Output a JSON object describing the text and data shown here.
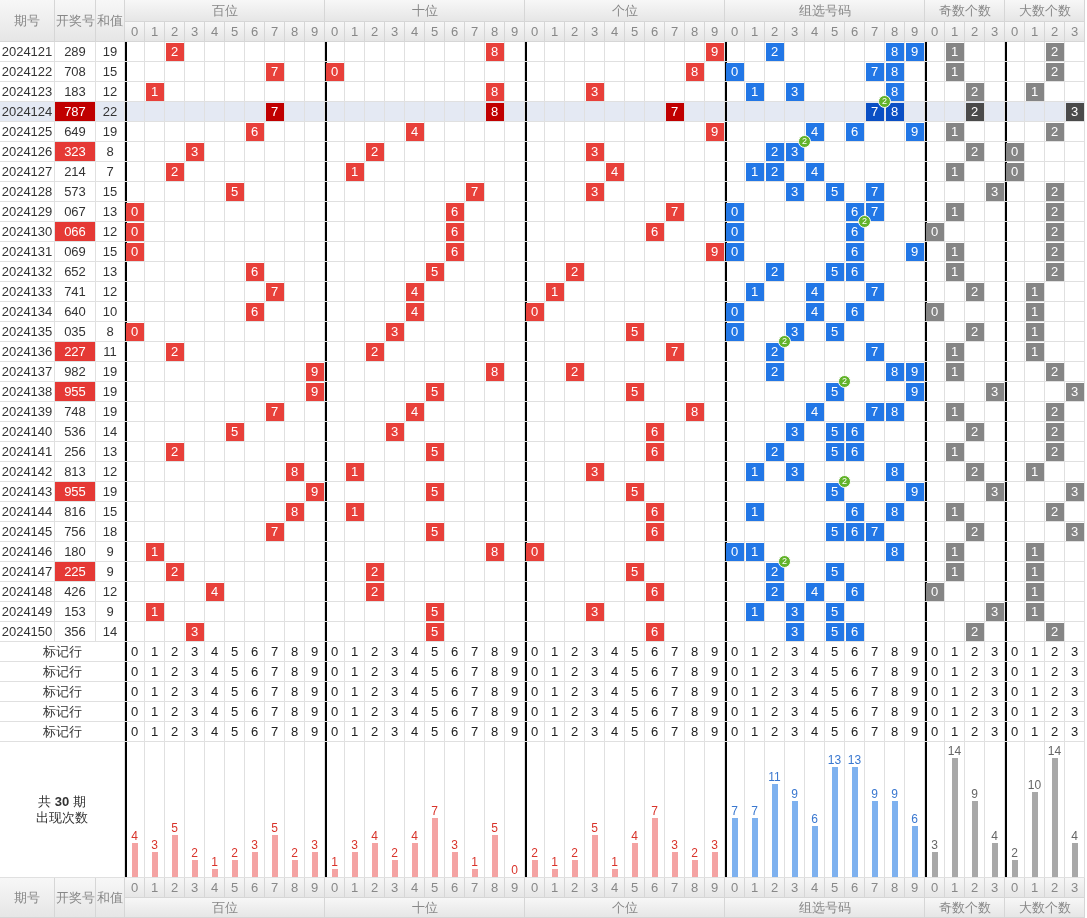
{
  "columns": [
    "期号",
    "开奖号",
    "和值"
  ],
  "groups": [
    {
      "label": "百位",
      "kind": "position",
      "digits": [
        "0",
        "1",
        "2",
        "3",
        "4",
        "5",
        "6",
        "7",
        "8",
        "9"
      ]
    },
    {
      "label": "十位",
      "kind": "position",
      "digits": [
        "0",
        "1",
        "2",
        "3",
        "4",
        "5",
        "6",
        "7",
        "8",
        "9"
      ]
    },
    {
      "label": "个位",
      "kind": "position",
      "digits": [
        "0",
        "1",
        "2",
        "3",
        "4",
        "5",
        "6",
        "7",
        "8",
        "9"
      ]
    },
    {
      "label": "组选号码",
      "kind": "group",
      "digits": [
        "0",
        "1",
        "2",
        "3",
        "4",
        "5",
        "6",
        "7",
        "8",
        "9"
      ]
    },
    {
      "label": "奇数个数",
      "kind": "odd",
      "digits": [
        "0",
        "1",
        "2",
        "3"
      ]
    },
    {
      "label": "大数个数",
      "kind": "big",
      "digits": [
        "0",
        "1",
        "2",
        "3"
      ]
    }
  ],
  "rows": [
    {
      "issue": "2024121",
      "number": "289",
      "sum": "19",
      "pair": false,
      "selected": false,
      "positions": [
        "2",
        "8",
        "9"
      ],
      "group": [
        {
          "digit": "2"
        },
        {
          "digit": "8"
        },
        {
          "digit": "9"
        }
      ],
      "odd": "1",
      "big": "2"
    },
    {
      "issue": "2024122",
      "number": "708",
      "sum": "15",
      "pair": false,
      "selected": false,
      "positions": [
        "7",
        "0",
        "8"
      ],
      "group": [
        {
          "digit": "0"
        },
        {
          "digit": "7"
        },
        {
          "digit": "8"
        }
      ],
      "odd": "1",
      "big": "2"
    },
    {
      "issue": "2024123",
      "number": "183",
      "sum": "12",
      "pair": false,
      "selected": false,
      "positions": [
        "1",
        "8",
        "3"
      ],
      "group": [
        {
          "digit": "1"
        },
        {
          "digit": "3"
        },
        {
          "digit": "8"
        }
      ],
      "odd": "2",
      "big": "1"
    },
    {
      "issue": "2024124",
      "number": "787",
      "sum": "22",
      "pair": true,
      "selected": true,
      "positions": [
        "7",
        "8",
        "7"
      ],
      "group": [
        {
          "digit": "7",
          "repeat": "2"
        },
        {
          "digit": "8"
        }
      ],
      "odd": "2",
      "big": "3"
    },
    {
      "issue": "2024125",
      "number": "649",
      "sum": "19",
      "pair": false,
      "selected": false,
      "positions": [
        "6",
        "4",
        "9"
      ],
      "group": [
        {
          "digit": "4"
        },
        {
          "digit": "6"
        },
        {
          "digit": "9"
        }
      ],
      "odd": "1",
      "big": "2"
    },
    {
      "issue": "2024126",
      "number": "323",
      "sum": "8",
      "pair": true,
      "selected": false,
      "positions": [
        "3",
        "2",
        "3"
      ],
      "group": [
        {
          "digit": "2"
        },
        {
          "digit": "3",
          "repeat": "2"
        }
      ],
      "odd": "2",
      "big": "0"
    },
    {
      "issue": "2024127",
      "number": "214",
      "sum": "7",
      "pair": false,
      "selected": false,
      "positions": [
        "2",
        "1",
        "4"
      ],
      "group": [
        {
          "digit": "1"
        },
        {
          "digit": "2"
        },
        {
          "digit": "4"
        }
      ],
      "odd": "1",
      "big": "0"
    },
    {
      "issue": "2024128",
      "number": "573",
      "sum": "15",
      "pair": false,
      "selected": false,
      "positions": [
        "5",
        "7",
        "3"
      ],
      "group": [
        {
          "digit": "3"
        },
        {
          "digit": "5"
        },
        {
          "digit": "7"
        }
      ],
      "odd": "3",
      "big": "2"
    },
    {
      "issue": "2024129",
      "number": "067",
      "sum": "13",
      "pair": false,
      "selected": false,
      "positions": [
        "0",
        "6",
        "7"
      ],
      "group": [
        {
          "digit": "0"
        },
        {
          "digit": "6"
        },
        {
          "digit": "7"
        }
      ],
      "odd": "1",
      "big": "2"
    },
    {
      "issue": "2024130",
      "number": "066",
      "sum": "12",
      "pair": true,
      "selected": false,
      "positions": [
        "0",
        "6",
        "6"
      ],
      "group": [
        {
          "digit": "0"
        },
        {
          "digit": "6",
          "repeat": "2"
        }
      ],
      "odd": "0",
      "big": "2"
    },
    {
      "issue": "2024131",
      "number": "069",
      "sum": "15",
      "pair": false,
      "selected": false,
      "positions": [
        "0",
        "6",
        "9"
      ],
      "group": [
        {
          "digit": "0"
        },
        {
          "digit": "6"
        },
        {
          "digit": "9"
        }
      ],
      "odd": "1",
      "big": "2"
    },
    {
      "issue": "2024132",
      "number": "652",
      "sum": "13",
      "pair": false,
      "selected": false,
      "positions": [
        "6",
        "5",
        "2"
      ],
      "group": [
        {
          "digit": "2"
        },
        {
          "digit": "5"
        },
        {
          "digit": "6"
        }
      ],
      "odd": "1",
      "big": "2"
    },
    {
      "issue": "2024133",
      "number": "741",
      "sum": "12",
      "pair": false,
      "selected": false,
      "positions": [
        "7",
        "4",
        "1"
      ],
      "group": [
        {
          "digit": "1"
        },
        {
          "digit": "4"
        },
        {
          "digit": "7"
        }
      ],
      "odd": "2",
      "big": "1"
    },
    {
      "issue": "2024134",
      "number": "640",
      "sum": "10",
      "pair": false,
      "selected": false,
      "positions": [
        "6",
        "4",
        "0"
      ],
      "group": [
        {
          "digit": "0"
        },
        {
          "digit": "4"
        },
        {
          "digit": "6"
        }
      ],
      "odd": "0",
      "big": "1"
    },
    {
      "issue": "2024135",
      "number": "035",
      "sum": "8",
      "pair": false,
      "selected": false,
      "positions": [
        "0",
        "3",
        "5"
      ],
      "group": [
        {
          "digit": "0"
        },
        {
          "digit": "3"
        },
        {
          "digit": "5"
        }
      ],
      "odd": "2",
      "big": "1"
    },
    {
      "issue": "2024136",
      "number": "227",
      "sum": "11",
      "pair": true,
      "selected": false,
      "positions": [
        "2",
        "2",
        "7"
      ],
      "group": [
        {
          "digit": "2",
          "repeat": "2"
        },
        {
          "digit": "7"
        }
      ],
      "odd": "1",
      "big": "1"
    },
    {
      "issue": "2024137",
      "number": "982",
      "sum": "19",
      "pair": false,
      "selected": false,
      "positions": [
        "9",
        "8",
        "2"
      ],
      "group": [
        {
          "digit": "2"
        },
        {
          "digit": "8"
        },
        {
          "digit": "9"
        }
      ],
      "odd": "1",
      "big": "2"
    },
    {
      "issue": "2024138",
      "number": "955",
      "sum": "19",
      "pair": true,
      "selected": false,
      "positions": [
        "9",
        "5",
        "5"
      ],
      "group": [
        {
          "digit": "5",
          "repeat": "2"
        },
        {
          "digit": "9"
        }
      ],
      "odd": "3",
      "big": "3"
    },
    {
      "issue": "2024139",
      "number": "748",
      "sum": "19",
      "pair": false,
      "selected": false,
      "positions": [
        "7",
        "4",
        "8"
      ],
      "group": [
        {
          "digit": "4"
        },
        {
          "digit": "7"
        },
        {
          "digit": "8"
        }
      ],
      "odd": "1",
      "big": "2"
    },
    {
      "issue": "2024140",
      "number": "536",
      "sum": "14",
      "pair": false,
      "selected": false,
      "positions": [
        "5",
        "3",
        "6"
      ],
      "group": [
        {
          "digit": "3"
        },
        {
          "digit": "5"
        },
        {
          "digit": "6"
        }
      ],
      "odd": "2",
      "big": "2"
    },
    {
      "issue": "2024141",
      "number": "256",
      "sum": "13",
      "pair": false,
      "selected": false,
      "positions": [
        "2",
        "5",
        "6"
      ],
      "group": [
        {
          "digit": "2"
        },
        {
          "digit": "5"
        },
        {
          "digit": "6"
        }
      ],
      "odd": "1",
      "big": "2"
    },
    {
      "issue": "2024142",
      "number": "813",
      "sum": "12",
      "pair": false,
      "selected": false,
      "positions": [
        "8",
        "1",
        "3"
      ],
      "group": [
        {
          "digit": "1"
        },
        {
          "digit": "3"
        },
        {
          "digit": "8"
        }
      ],
      "odd": "2",
      "big": "1"
    },
    {
      "issue": "2024143",
      "number": "955",
      "sum": "19",
      "pair": true,
      "selected": false,
      "positions": [
        "9",
        "5",
        "5"
      ],
      "group": [
        {
          "digit": "5",
          "repeat": "2"
        },
        {
          "digit": "9"
        }
      ],
      "odd": "3",
      "big": "3"
    },
    {
      "issue": "2024144",
      "number": "816",
      "sum": "15",
      "pair": false,
      "selected": false,
      "positions": [
        "8",
        "1",
        "6"
      ],
      "group": [
        {
          "digit": "1"
        },
        {
          "digit": "6"
        },
        {
          "digit": "8"
        }
      ],
      "odd": "1",
      "big": "2"
    },
    {
      "issue": "2024145",
      "number": "756",
      "sum": "18",
      "pair": false,
      "selected": false,
      "positions": [
        "7",
        "5",
        "6"
      ],
      "group": [
        {
          "digit": "5"
        },
        {
          "digit": "6"
        },
        {
          "digit": "7"
        }
      ],
      "odd": "2",
      "big": "3"
    },
    {
      "issue": "2024146",
      "number": "180",
      "sum": "9",
      "pair": false,
      "selected": false,
      "positions": [
        "1",
        "8",
        "0"
      ],
      "group": [
        {
          "digit": "0"
        },
        {
          "digit": "1"
        },
        {
          "digit": "8"
        }
      ],
      "odd": "1",
      "big": "1"
    },
    {
      "issue": "2024147",
      "number": "225",
      "sum": "9",
      "pair": true,
      "selected": false,
      "positions": [
        "2",
        "2",
        "5"
      ],
      "group": [
        {
          "digit": "2",
          "repeat": "2"
        },
        {
          "digit": "5"
        }
      ],
      "odd": "1",
      "big": "1"
    },
    {
      "issue": "2024148",
      "number": "426",
      "sum": "12",
      "pair": false,
      "selected": false,
      "positions": [
        "4",
        "2",
        "6"
      ],
      "group": [
        {
          "digit": "2"
        },
        {
          "digit": "4"
        },
        {
          "digit": "6"
        }
      ],
      "odd": "0",
      "big": "1"
    },
    {
      "issue": "2024149",
      "number": "153",
      "sum": "9",
      "pair": false,
      "selected": false,
      "positions": [
        "1",
        "5",
        "3"
      ],
      "group": [
        {
          "digit": "1"
        },
        {
          "digit": "3"
        },
        {
          "digit": "5"
        }
      ],
      "odd": "3",
      "big": "1"
    },
    {
      "issue": "2024150",
      "number": "356",
      "sum": "14",
      "pair": false,
      "selected": false,
      "positions": [
        "3",
        "5",
        "6"
      ],
      "group": [
        {
          "digit": "3"
        },
        {
          "digit": "5"
        },
        {
          "digit": "6"
        }
      ],
      "odd": "2",
      "big": "2"
    }
  ],
  "mark_rows": [
    {
      "label": "标记行",
      "digits": [
        [
          "0",
          "1",
          "2",
          "3",
          "4",
          "5",
          "6",
          "7",
          "8",
          "9"
        ],
        [
          "0",
          "1",
          "2",
          "3",
          "4",
          "5",
          "6",
          "7",
          "8",
          "9"
        ],
        [
          "0",
          "1",
          "2",
          "3",
          "4",
          "5",
          "6",
          "7",
          "8",
          "9"
        ],
        [
          "0",
          "1",
          "2",
          "3",
          "4",
          "5",
          "6",
          "7",
          "8",
          "9"
        ],
        [
          "0",
          "1",
          "2",
          "3"
        ],
        [
          "0",
          "1",
          "2",
          "3"
        ]
      ]
    },
    {
      "label": "标记行",
      "digits": [
        [
          "0",
          "1",
          "2",
          "3",
          "4",
          "5",
          "6",
          "7",
          "8",
          "9"
        ],
        [
          "0",
          "1",
          "2",
          "3",
          "4",
          "5",
          "6",
          "7",
          "8",
          "9"
        ],
        [
          "0",
          "1",
          "2",
          "3",
          "4",
          "5",
          "6",
          "7",
          "8",
          "9"
        ],
        [
          "0",
          "1",
          "2",
          "3",
          "4",
          "5",
          "6",
          "7",
          "8",
          "9"
        ],
        [
          "0",
          "1",
          "2",
          "3"
        ],
        [
          "0",
          "1",
          "2",
          "3"
        ]
      ]
    },
    {
      "label": "标记行",
      "digits": [
        [
          "0",
          "1",
          "2",
          "3",
          "4",
          "5",
          "6",
          "7",
          "8",
          "9"
        ],
        [
          "0",
          "1",
          "2",
          "3",
          "4",
          "5",
          "6",
          "7",
          "8",
          "9"
        ],
        [
          "0",
          "1",
          "2",
          "3",
          "4",
          "5",
          "6",
          "7",
          "8",
          "9"
        ],
        [
          "0",
          "1",
          "2",
          "3",
          "4",
          "5",
          "6",
          "7",
          "8",
          "9"
        ],
        [
          "0",
          "1",
          "2",
          "3"
        ],
        [
          "0",
          "1",
          "2",
          "3"
        ]
      ]
    },
    {
      "label": "标记行",
      "digits": [
        [
          "0",
          "1",
          "2",
          "3",
          "4",
          "5",
          "6",
          "7",
          "8",
          "9"
        ],
        [
          "0",
          "1",
          "2",
          "3",
          "4",
          "5",
          "6",
          "7",
          "8",
          "9"
        ],
        [
          "0",
          "1",
          "2",
          "3",
          "4",
          "5",
          "6",
          "7",
          "8",
          "9"
        ],
        [
          "0",
          "1",
          "2",
          "3",
          "4",
          "5",
          "6",
          "7",
          "8",
          "9"
        ],
        [
          "0",
          "1",
          "2",
          "3"
        ],
        [
          "0",
          "1",
          "2",
          "3"
        ]
      ]
    },
    {
      "label": "标记行",
      "digits": [
        [
          "0",
          "1",
          "2",
          "3",
          "4",
          "5",
          "6",
          "7",
          "8",
          "9"
        ],
        [
          "0",
          "1",
          "2",
          "3",
          "4",
          "5",
          "6",
          "7",
          "8",
          "9"
        ],
        [
          "0",
          "1",
          "2",
          "3",
          "4",
          "5",
          "6",
          "7",
          "8",
          "9"
        ],
        [
          "0",
          "1",
          "2",
          "3",
          "4",
          "5",
          "6",
          "7",
          "8",
          "9"
        ],
        [
          "0",
          "1",
          "2",
          "3"
        ],
        [
          "0",
          "1",
          "2",
          "3"
        ]
      ]
    }
  ],
  "stats": {
    "label_lines": [
      "共 **30** 期",
      "出现次数"
    ],
    "counts": [
      [
        "4",
        "3",
        "5",
        "2",
        "1",
        "2",
        "3",
        "5",
        "2",
        "3"
      ],
      [
        "1",
        "3",
        "4",
        "2",
        "4",
        "7",
        "3",
        "1",
        "5",
        "0"
      ],
      [
        "2",
        "1",
        "2",
        "5",
        "1",
        "4",
        "7",
        "3",
        "2",
        "3"
      ],
      [
        "7",
        "7",
        "11",
        "9",
        "6",
        "13",
        "13",
        "9",
        "9",
        "6"
      ],
      [
        "3",
        "14",
        "9",
        "4"
      ],
      [
        "2",
        "10",
        "14",
        "4"
      ]
    ]
  },
  "footer": {
    "columns": [
      "期号",
      "开奖号",
      "和值"
    ],
    "groups": [
      {
        "label": "百位",
        "digits": [
          "0",
          "1",
          "2",
          "3",
          "4",
          "5",
          "6",
          "7",
          "8",
          "9"
        ]
      },
      {
        "label": "十位",
        "digits": [
          "0",
          "1",
          "2",
          "3",
          "4",
          "5",
          "6",
          "7",
          "8",
          "9"
        ]
      },
      {
        "label": "个位",
        "digits": [
          "0",
          "1",
          "2",
          "3",
          "4",
          "5",
          "6",
          "7",
          "8",
          "9"
        ]
      },
      {
        "label": "组选号码",
        "digits": [
          "0",
          "1",
          "2",
          "3",
          "4",
          "5",
          "6",
          "7",
          "8",
          "9"
        ]
      },
      {
        "label": "奇数个数",
        "digits": [
          "0",
          "1",
          "2",
          "3"
        ]
      },
      {
        "label": "大数个数",
        "digits": [
          "0",
          "1",
          "2",
          "3"
        ]
      }
    ]
  }
}
